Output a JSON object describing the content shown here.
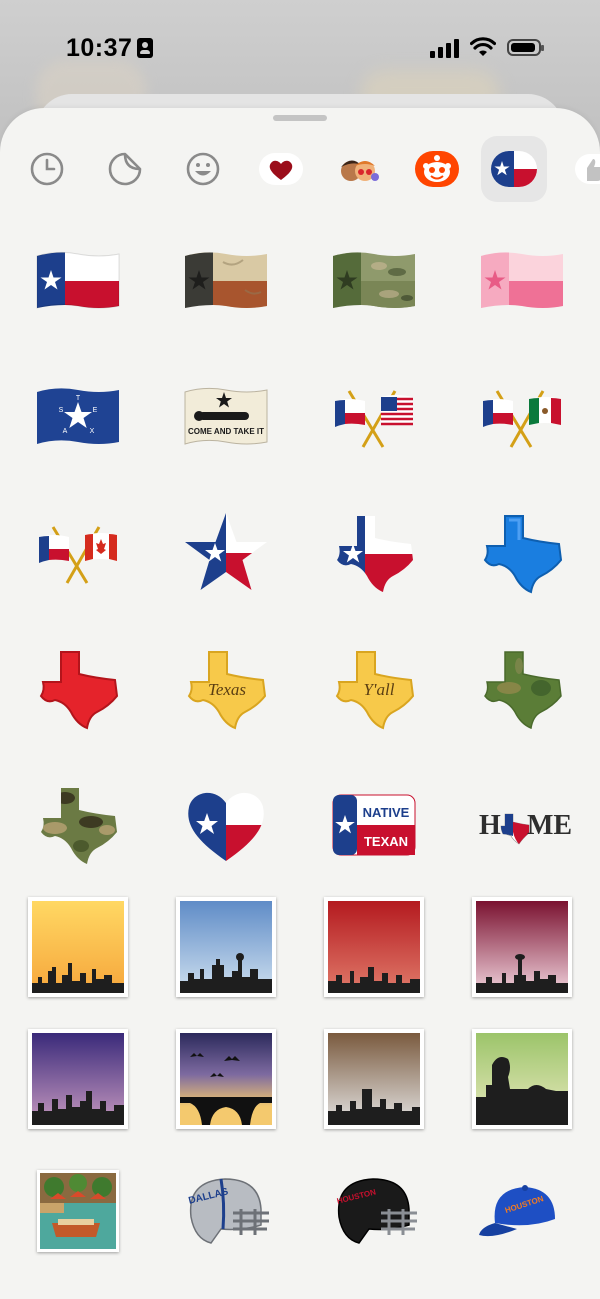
{
  "status_bar": {
    "time": "10:37"
  },
  "categories": [
    {
      "name": "recent"
    },
    {
      "name": "stickers"
    },
    {
      "name": "emoji"
    },
    {
      "name": "favorites-heart"
    },
    {
      "name": "memoji"
    },
    {
      "name": "reddit-sticker-pack"
    },
    {
      "name": "texas-sticker-pack",
      "selected": true
    },
    {
      "name": "thumbs-up-pack"
    }
  ],
  "stickers": [
    {
      "name": "texas-flag"
    },
    {
      "name": "vintage-texas-flag"
    },
    {
      "name": "camo-texas-flag"
    },
    {
      "name": "pink-texas-flag"
    },
    {
      "name": "burnet-flag",
      "text": [
        "T",
        "E",
        "X",
        "A",
        "S"
      ]
    },
    {
      "name": "come-and-take-it-flag",
      "text": "COME AND TAKE IT"
    },
    {
      "name": "texas-usa-crossed-flags"
    },
    {
      "name": "texas-mexico-crossed-flags"
    },
    {
      "name": "texas-canada-crossed-flags"
    },
    {
      "name": "texas-star"
    },
    {
      "name": "texas-map-flag"
    },
    {
      "name": "blue-texas-map"
    },
    {
      "name": "red-texas-map"
    },
    {
      "name": "texas-map-texas-text",
      "text": "Texas"
    },
    {
      "name": "texas-map-yall-text",
      "text": "Y'all"
    },
    {
      "name": "satellite-texas-map"
    },
    {
      "name": "camo-texas-map"
    },
    {
      "name": "texas-heart"
    },
    {
      "name": "native-texan-badge",
      "text": [
        "NATIVE",
        "TEXAN"
      ]
    },
    {
      "name": "home-texas",
      "text": [
        "H",
        "ME"
      ]
    },
    {
      "name": "skyline-sunset-yellow"
    },
    {
      "name": "skyline-dallas-blue"
    },
    {
      "name": "skyline-red"
    },
    {
      "name": "skyline-san-antonio"
    },
    {
      "name": "skyline-purple-dusk"
    },
    {
      "name": "austin-bridge-bats"
    },
    {
      "name": "skyline-brown"
    },
    {
      "name": "rock-formation-green"
    },
    {
      "name": "river-walk-boat"
    },
    {
      "name": "dallas-helmet",
      "text": "DALLAS"
    },
    {
      "name": "houston-helmet",
      "text": "HOUSTON"
    },
    {
      "name": "houston-cap",
      "text": "HOUSTON"
    }
  ],
  "colors": {
    "sheet": "#f4f4f2",
    "selected_tab": "#e6e6e6",
    "texas_blue": "#1d3f8c",
    "texas_red": "#c8102e"
  }
}
